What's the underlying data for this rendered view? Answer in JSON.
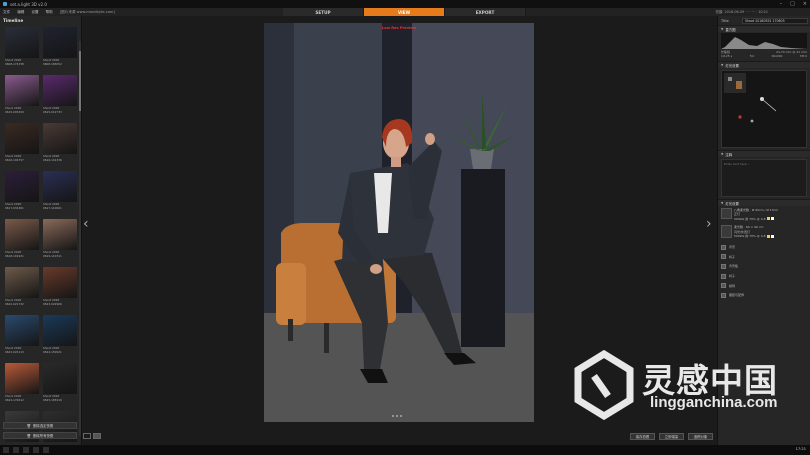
{
  "window": {
    "title": "set.a.light 3D v2.0"
  },
  "menubar": {
    "items": [
      "文件",
      "编辑",
      "设置",
      "帮助"
    ],
    "url": "[图片来源 www.mondbyte.com]"
  },
  "mode_tabs": [
    {
      "label": "SETUP",
      "active": false
    },
    {
      "label": "VIEW",
      "active": true
    },
    {
      "label": "EXPORT",
      "active": false
    }
  ],
  "date_readout": "拍摄: 2018-06-09 ··· · ··· · 10:21",
  "timeline": {
    "title": "Timeline",
    "thumbnails": [
      {
        "line1": "Shoot 2018",
        "line2": "0608-174338",
        "color": "#2a2e3a"
      },
      {
        "line1": "Shoot 2018",
        "line2": "0608-183052",
        "color": "#1f2330"
      },
      {
        "line1": "Shoot 2018",
        "line2": "0615-003209",
        "color": "#8a5b8f"
      },
      {
        "line1": "Shoot 2018",
        "line2": "0615-012733",
        "color": "#5a2a6e"
      },
      {
        "line1": "Shoot 2018",
        "line2": "0616-104757",
        "color": "#3b2a22"
      },
      {
        "line1": "Shoot 2018",
        "line2": "0616-141336",
        "color": "#4a3a35"
      },
      {
        "line1": "Shoot 2018",
        "line2": "0617-032461",
        "color": "#2c1e3a"
      },
      {
        "line1": "Shoot 2018",
        "line2": "0617-110601",
        "color": "#2a2f55"
      },
      {
        "line1": "Shoot 2018",
        "line2": "0618-101921",
        "color": "#7a5a4a"
      },
      {
        "line1": "Shoot 2018",
        "line2": "0619-110311",
        "color": "#8a6a5a"
      },
      {
        "line1": "Shoot 2018",
        "line2": "0622-021732",
        "color": "#6e5a4a"
      },
      {
        "line1": "Shoot 2018",
        "line2": "0623-022906",
        "color": "#6a3a2a"
      },
      {
        "line1": "Shoot 2018",
        "line2": "0623-024113",
        "color": "#2a4a6e"
      },
      {
        "line1": "Shoot 2018",
        "line2": "0624-150921",
        "color": "#1a3a5a"
      },
      {
        "line1": "Shoot 2018",
        "line2": "0624-174612",
        "color": "#b85a3a"
      },
      {
        "line1": "Shoot 2018",
        "line2": "0625-185919",
        "color": "#2a2a2a"
      },
      {
        "line1": "",
        "line2": "",
        "color": "#3a3a3a"
      },
      {
        "line1": "",
        "line2": "",
        "color": "#2e2e2e"
      }
    ],
    "button_batch": "删除选定快照",
    "button_all": "删除所有快照"
  },
  "viewport": {
    "photo_label": "Low Res Preview",
    "left_arrow": "‹",
    "right_arrow": "›",
    "bottom_buttons": [
      "保存拍照",
      "立即渲染",
      "追踪对象"
    ]
  },
  "right_panel": {
    "title_label": "Title",
    "title_value": "Shoot 20180925 170605",
    "section_exif": "直方图",
    "exif_row1": [
      "长焦镜",
      "24-70 mm @ 41 mm"
    ],
    "exif_row2": [
      "1/125 s",
      "f/4",
      "ISO200",
      "f/8.0"
    ],
    "section_map": "灯光设置",
    "section_notes": "注释",
    "notes_placeholder": "Enter text here...",
    "section_lights": "灯光设置",
    "light1": {
      "line1": "八角柔光箱 · Ø 90cm / Ø 13cm",
      "line2": "正灯",
      "line3": "500Ws 的 70% @ 4.8"
    },
    "light2": {
      "line1": "柔光箱 · 60 × 90 cm",
      "line2": "闪光/外置灯",
      "line3": "500Ws 的 70% @ 4.8"
    },
    "props": [
      "背景",
      "椅子",
      "背景板",
      "椅子",
      "模特",
      "服装与配饰"
    ]
  },
  "taskbar": {
    "clock": "17:21"
  },
  "watermark": {
    "cn": "灵感中国",
    "en": "lingganchina.com"
  }
}
